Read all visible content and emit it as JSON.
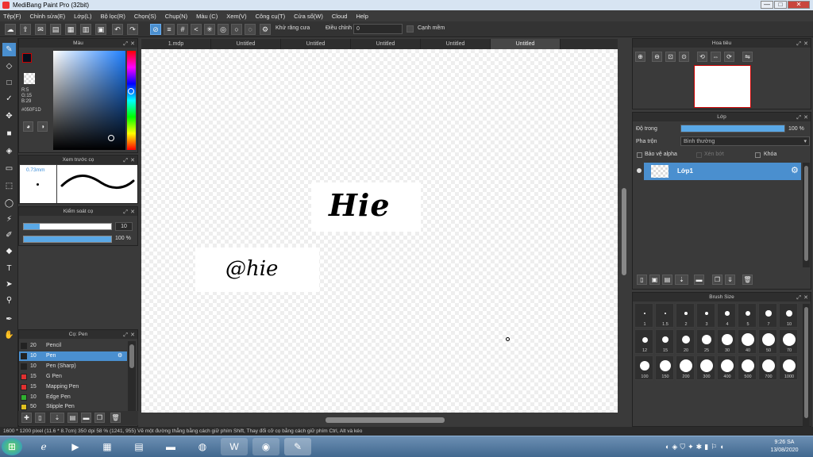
{
  "window": {
    "title": "MediBang Paint Pro (32bit)",
    "min": "—",
    "max": "□",
    "close": "✕"
  },
  "menu": [
    "Tệp(F)",
    "Chỉnh sửa(E)",
    "Lớp(L)",
    "Bộ lọc(R)",
    "Chọn(S)",
    "Chụp(N)",
    "Màu (C)",
    "Xem(V)",
    "Công cụ(T)",
    "Cửa sổ(W)",
    "Cloud",
    "Help"
  ],
  "toolbar": {
    "antialias_label": "Khử răng cưa",
    "correction_label": "Điều chỉnh",
    "correction_value": "0",
    "snap_label": "Cạnh mềm"
  },
  "tabs": [
    {
      "label": "1.mdp",
      "active": false
    },
    {
      "label": "Untitled",
      "active": false
    },
    {
      "label": "Untitled",
      "active": false
    },
    {
      "label": "Untitled",
      "active": false
    },
    {
      "label": "Untitled",
      "active": false
    },
    {
      "label": "Untitled",
      "active": true
    }
  ],
  "color_panel": {
    "title": "Màu",
    "r": "R:5",
    "g": "G:15",
    "b": "B:29",
    "hex": "#050F1D",
    "fg_color": "#050f1d"
  },
  "brush_preview": {
    "title": "Xem trước cọ",
    "size": "0.73mm"
  },
  "brush_control": {
    "title": "Kiểm soát cọ",
    "size_value": "10",
    "opacity_value": "100 %"
  },
  "brush_list": {
    "title": "Cọ: Pen",
    "items": [
      {
        "size": "20",
        "name": "Pencil",
        "color": "#222222",
        "selected": false
      },
      {
        "size": "10",
        "name": "Pen",
        "color": "#222222",
        "selected": true
      },
      {
        "size": "10",
        "name": "Pen (Sharp)",
        "color": "#222222",
        "selected": false
      },
      {
        "size": "15",
        "name": "G Pen",
        "color": "#e03030",
        "selected": false
      },
      {
        "size": "15",
        "name": "Mapping Pen",
        "color": "#e03030",
        "selected": false
      },
      {
        "size": "10",
        "name": "Edge Pen",
        "color": "#30b030",
        "selected": false
      },
      {
        "size": "50",
        "name": "Stipple Pen",
        "color": "#e0c020",
        "selected": false
      }
    ]
  },
  "canvas": {
    "text1": "Hie",
    "text2": "@hie"
  },
  "navigator": {
    "title": "Hoa tiêu"
  },
  "layer_panel": {
    "title": "Lớp",
    "opacity_label": "Độ trong",
    "opacity_value": "100 %",
    "opacity_level": 1.0,
    "blend_label": "Pha trộn",
    "blend_value": "Bình thường",
    "protect_alpha": "Bảo vệ alpha",
    "clipping": "Xén bớt",
    "lock": "Khóa",
    "layer_name": "Lớp1"
  },
  "brush_size": {
    "title": "Brush Size",
    "row1": [
      "1",
      "1.5",
      "2",
      "3",
      "4",
      "5",
      "7",
      "10"
    ],
    "row2": [
      "12",
      "15",
      "20",
      "25",
      "30",
      "40",
      "50",
      "70"
    ],
    "row3": [
      "100",
      "150",
      "200",
      "300",
      "400",
      "500",
      "700",
      "1000"
    ]
  },
  "status": "1600 * 1200 pixel  (11.6 * 8.7cm)  350 dpi  58 %  (1241, 955)  Vẽ một đường thẳng bằng cách giữ phím Shift, Thay đổi cỡ cọ bằng cách giữ phím Ctrl, Alt và kéo",
  "tray": {
    "time": "9:26 SA",
    "date": "13/08/2020"
  }
}
